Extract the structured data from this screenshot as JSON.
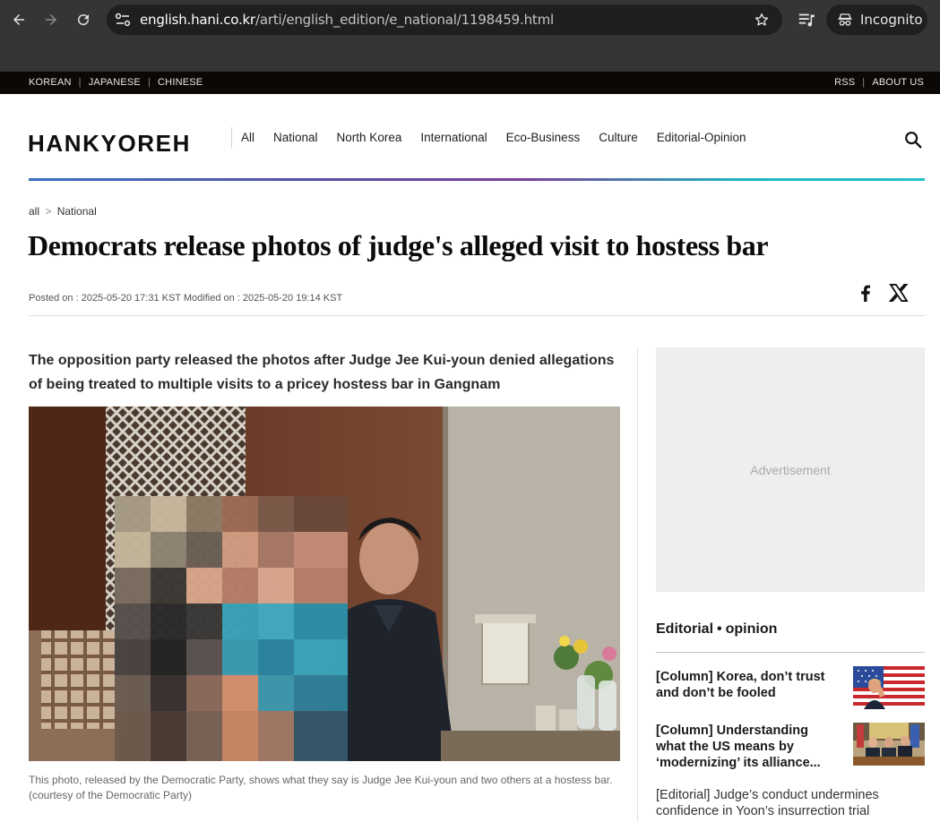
{
  "browser": {
    "url_host": "english.hani.co.kr",
    "url_path": "/arti/english_edition/e_national/1198459.html",
    "incognito_label": "Incognito"
  },
  "util_bar": {
    "languages": [
      "KOREAN",
      "JAPANESE",
      "CHINESE"
    ],
    "right_links": [
      "RSS",
      "ABOUT US"
    ]
  },
  "header": {
    "logo": "HANKYOREH",
    "nav": [
      "All",
      "National",
      "North Korea",
      "International",
      "Eco-Business",
      "Culture",
      "Editorial-Opinion"
    ]
  },
  "article": {
    "breadcrumb": {
      "root": "all",
      "sep": ">",
      "section": "National"
    },
    "headline": "Democrats release photos of judge's alleged visit to hostess bar",
    "dates": "Posted on : 2025-05-20 17:31 KST Modified on : 2025-05-20 19:14 KST",
    "subhead": "The opposition party released the photos after Judge Jee Kui-youn denied allegations of being treated to multiple visits to a pricey hostess bar in Gangnam",
    "caption": "This photo, released by the Democratic Party, shows what they say is Judge Jee Kui-youn and two others at a hostess bar. (courtesy of the Democratic Party)",
    "share_icons": [
      "facebook-icon",
      "x-icon"
    ]
  },
  "sidebar": {
    "ad_label": "Advertisement",
    "section_title_left": "Editorial",
    "section_title_dot": "•",
    "section_title_right": "opinion",
    "items": [
      {
        "text": "[Column] Korea, don’t trust and don’t be fooled"
      },
      {
        "text": "[Column] Understanding what the US means by ‘modernizing’ its alliance..."
      },
      {
        "text": "[Editorial] Judge’s conduct undermines confidence in Yoon’s insurrection trial"
      }
    ]
  },
  "colors": {
    "chrome_bg": "#353535",
    "omnibox_bg": "#1f1f1f",
    "util_bar_bg": "#0c0805",
    "rule_gradient_start": "#3a6fbf",
    "rule_gradient_end": "#24c0c8",
    "ad_bg": "#eeeeee"
  }
}
